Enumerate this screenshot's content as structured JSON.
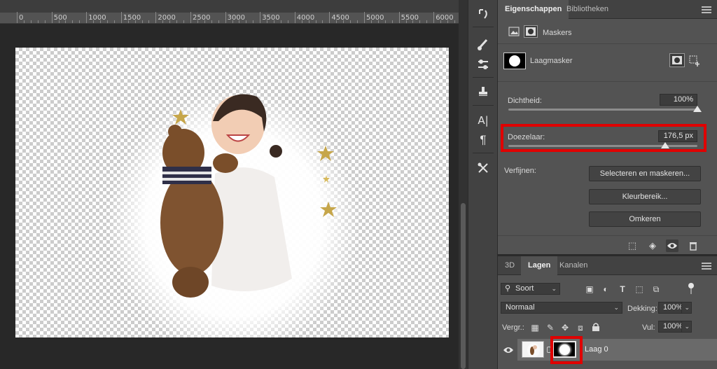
{
  "ruler": {
    "ticks": [
      "0",
      "500",
      "1000",
      "1500",
      "2000",
      "2500",
      "3000",
      "3500",
      "4000",
      "4500",
      "5000",
      "5500",
      "6000"
    ]
  },
  "canvas": {
    "description_icon": "photo-icon"
  },
  "tools": [
    {
      "name": "history-brush-icon",
      "glyph": "↺"
    },
    {
      "name": "brush-settings-icon",
      "glyph": "✎"
    },
    {
      "name": "brush-presets-icon",
      "glyph": "⚲"
    },
    {
      "name": "clone-source-icon",
      "glyph": "⎘"
    },
    {
      "name": "character-icon",
      "glyph": "A|"
    },
    {
      "name": "paragraph-icon",
      "glyph": "¶"
    },
    {
      "name": "tool-presets-icon",
      "glyph": "✂"
    }
  ],
  "properties": {
    "tabs": [
      "Eigenschappen",
      "Bibliotheken"
    ],
    "section_title": "Maskers",
    "mask_label": "Laagmasker",
    "density_label": "Dichtheid:",
    "density_value": "100%",
    "density_level": 1.0,
    "feather_label": "Doezelaar:",
    "feather_value": "176,5 px",
    "feather_level": 0.83,
    "refine_label": "Verfijnen:",
    "buttons": [
      "Selecteren en maskeren...",
      "Kleurbereik...",
      "Omkeren"
    ]
  },
  "layers": {
    "tabs": [
      "3D",
      "Lagen",
      "Kanalen"
    ],
    "filter_label": "Soort",
    "blend_mode": "Normaal",
    "opacity_label": "Dekking:",
    "opacity_value": "100%",
    "lock_label": "Vergr.:",
    "fill_label": "Vul:",
    "fill_value": "100%",
    "layer_name": "Laag 0"
  },
  "colors": {
    "highlight": "#e00000",
    "accent_active_tab": "#535353"
  }
}
